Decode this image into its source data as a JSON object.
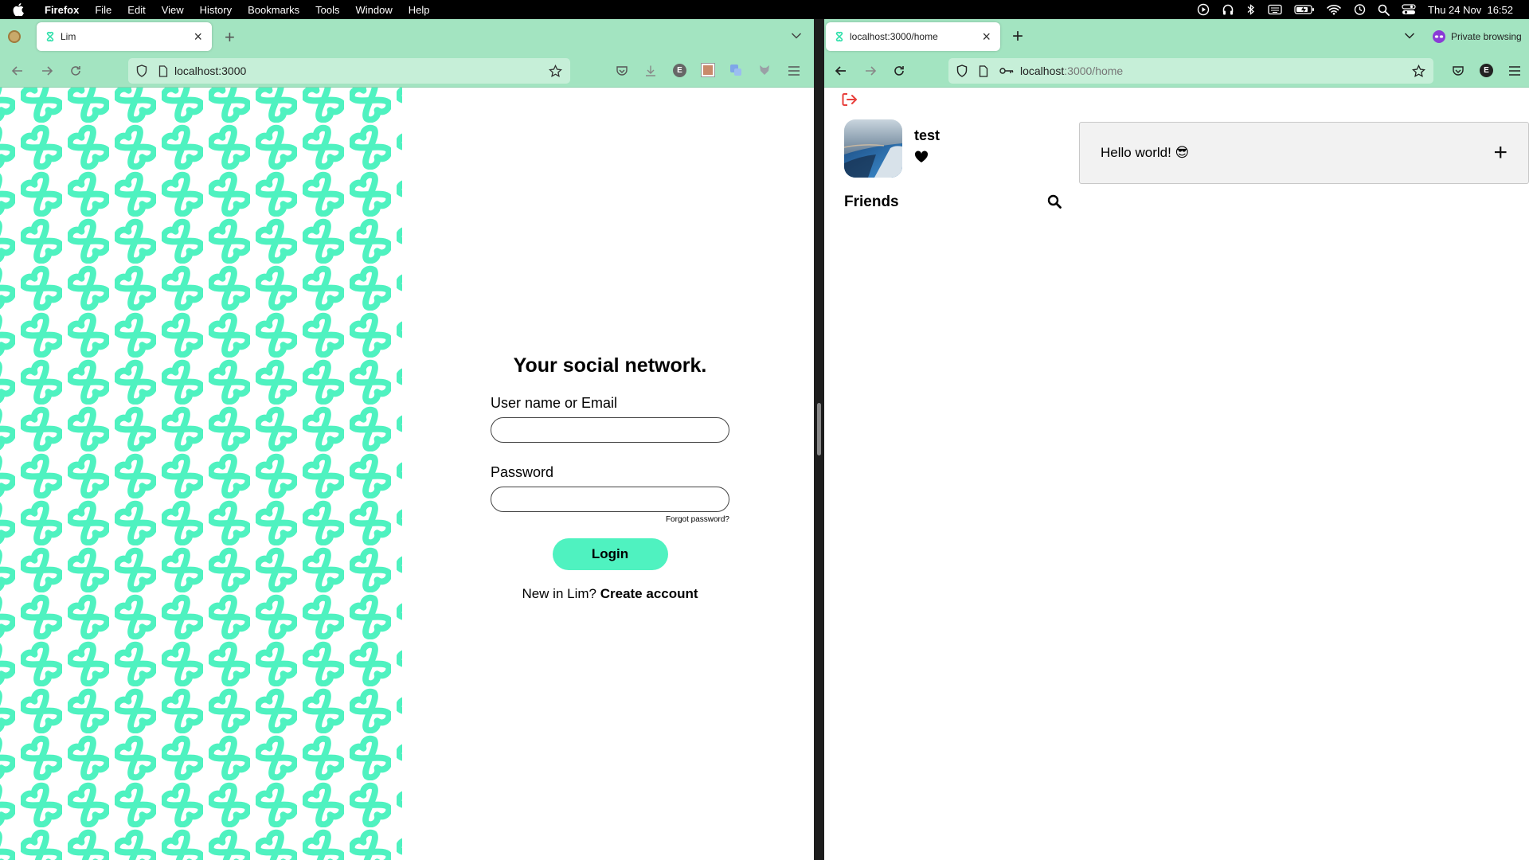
{
  "menubar": {
    "app": "Firefox",
    "items": [
      "File",
      "Edit",
      "View",
      "History",
      "Bookmarks",
      "Tools",
      "Window",
      "Help"
    ],
    "clock": "Thu 24 Nov  16:52"
  },
  "left_window": {
    "tab_title": "Lim",
    "url": "localhost:3000",
    "form": {
      "heading": "Your social network.",
      "username_label": "User name or Email",
      "username_value": "",
      "password_label": "Password",
      "password_value": "",
      "forgot": "Forgot password?",
      "login": "Login",
      "signup_prefix": "New in Lim?",
      "signup_link": "Create account"
    },
    "pattern_color": "#4ff2c0"
  },
  "right_window": {
    "tab_title": "localhost:3000/home",
    "private_label": "Private browsing",
    "url_host": "localhost",
    "url_rest": ":3000/home",
    "profile": {
      "username": "test"
    },
    "friends_title": "Friends",
    "post_text": "Hello world! 😎",
    "add_label": "+"
  },
  "colors": {
    "toolbar": "#a3e4c1",
    "accent": "#4ff2c0",
    "logout": "#e8403d"
  }
}
